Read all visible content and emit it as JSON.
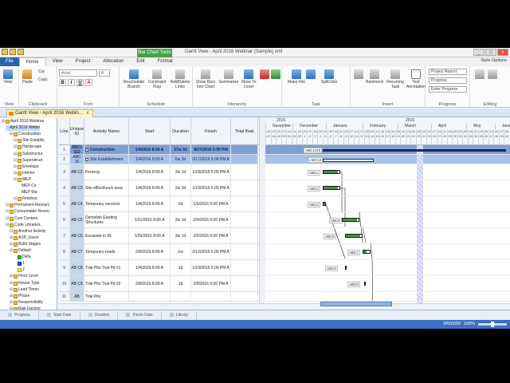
{
  "window": {
    "context_tab": "Bar Chart Tools",
    "title": "Gantt View - April 2016 Webinar (Sample).xml",
    "controls": [
      "_",
      "□",
      "x"
    ]
  },
  "ribbon_tabs": [
    "File",
    "Home",
    "View",
    "Project",
    "Allocation",
    "Edit",
    "Format"
  ],
  "style_options": "Style Options",
  "ribbon": {
    "view": {
      "label": "View",
      "group": "View"
    },
    "clipboard": {
      "paste": "Paste",
      "cut": "Cut",
      "copy": "Copy",
      "group": "Clipboard"
    },
    "font": {
      "name": "Arial",
      "size": "8",
      "group": "Font",
      "buttons": [
        "B",
        "I",
        "U",
        "A"
      ]
    },
    "schedule": {
      "reschedule": "Reschedule Branch",
      "constraint": "Constraint Flag",
      "add_links": "Add/Delete Links",
      "group": "Schedule"
    },
    "hierarchy": {
      "show_bars": "Show Bars Into Chart",
      "summarize": "Summarize",
      "show_to_level": "Show To Level",
      "group": "Hierarchy"
    },
    "task": {
      "make_into": "Make Into",
      "split_join": "Split/Join",
      "group": "Task"
    },
    "insert": {
      "hammock": "Hammock",
      "recurring": "Recurring Task",
      "text_annotation": "Text Annotation",
      "group": "Insert"
    },
    "progress": {
      "project_report": "Project Report",
      "progress": "Progress",
      "enter_progress": "Enter Progress",
      "group": "Progress"
    },
    "editing": {
      "group": "Editing"
    }
  },
  "doc_tab": {
    "label": "Gantt View - April 2016 Webin...",
    "close": "x"
  },
  "tree": [
    {
      "label": "April 2016 Webinar",
      "level": 0,
      "icon": "folder"
    },
    {
      "label": "April 2016 Webin",
      "level": 1,
      "icon": "grid",
      "selected": true
    },
    {
      "label": "Construction",
      "level": 2,
      "icon": "folder"
    },
    {
      "label": "Site Establis",
      "level": 3,
      "icon": "folder"
    },
    {
      "label": "Hardscape",
      "level": 3,
      "icon": "folder"
    },
    {
      "label": "Substructur",
      "level": 3,
      "icon": "folder"
    },
    {
      "label": "Superstruct",
      "level": 3,
      "icon": "folder"
    },
    {
      "label": "Envelope",
      "level": 3,
      "icon": "folder"
    },
    {
      "label": "Interior",
      "level": 3,
      "icon": "folder"
    },
    {
      "label": "MEP",
      "level": 3,
      "icon": "folder"
    },
    {
      "label": "MEP Ce",
      "level": 4,
      "icon": "grid"
    },
    {
      "label": "MEP Wa",
      "level": 4,
      "icon": "grid"
    },
    {
      "label": "Finishes",
      "level": 3,
      "icon": "folder"
    },
    {
      "label": "Permanent Resourc",
      "level": 1,
      "icon": "folder"
    },
    {
      "label": "Consumable Resou",
      "level": 1,
      "icon": "folder"
    },
    {
      "label": "Cost Centers",
      "level": 1,
      "icon": "folder"
    },
    {
      "label": "Code Libraries",
      "level": 1,
      "icon": "folder"
    },
    {
      "label": "Another Activity",
      "level": 2,
      "icon": "folder"
    },
    {
      "label": "ASP_Users",
      "level": 2,
      "icon": "folder"
    },
    {
      "label": "Build Stages",
      "level": 2,
      "icon": "folder"
    },
    {
      "label": "Default",
      "level": 2,
      "icon": "folder"
    },
    {
      "label": "Defa",
      "level": 3,
      "icon": "sw-green"
    },
    {
      "label": "1",
      "level": 3,
      "icon": "sw-blue"
    },
    {
      "label": "2",
      "level": 3,
      "icon": "sw-yellow"
    },
    {
      "label": "Floor Level",
      "level": 2,
      "icon": "folder"
    },
    {
      "label": "House Type",
      "level": 2,
      "icon": "folder"
    },
    {
      "label": "Lead Times",
      "level": 2,
      "icon": "folder"
    },
    {
      "label": "Phase",
      "level": 2,
      "icon": "folder"
    },
    {
      "label": "Responsibility",
      "level": 2,
      "icon": "folder"
    },
    {
      "label": "Risk Factors",
      "level": 2,
      "icon": "folder"
    }
  ],
  "grid": {
    "headers": [
      "Line",
      "Unique ID",
      "Activity Name",
      "Start",
      "Duration",
      "Finish",
      "Total float"
    ],
    "rows": [
      {
        "line": "1",
        "uid": "ABC1 310",
        "name": "Construction",
        "start": "1/4/2016 8:00 A",
        "duration": "37w 3d",
        "finish": "8/27/2016 5:00 PM",
        "float": "",
        "kind": "sum1"
      },
      {
        "line": "2",
        "uid": "ABC 10",
        "name": "Site Establishment",
        "start": "1/4/2016 8:00 A",
        "duration": "6w 3d",
        "finish": "2/17/2016 5:00 PM A",
        "float": "",
        "kind": "sum2"
      },
      {
        "line": "3",
        "uid": "AB C2",
        "name": "Fencing",
        "start": "1/4/2016 8:00 A",
        "duration": "2w 1d",
        "finish": "1/18/2016 5:00 PM A",
        "float": "",
        "kind": "task"
      },
      {
        "line": "4",
        "uid": "AB C3",
        "name": "Site office/lunch area",
        "start": "1/4/2016 8:00 A",
        "duration": "2w 2d",
        "finish": "1/19/2016 5:00 PM A",
        "float": "",
        "kind": "task"
      },
      {
        "line": "5",
        "uid": "AB C4",
        "name": "Temporary services",
        "start": "1/4/2016 8:00 A",
        "duration": "2d",
        "finish": "1/5/2016 5:00 PM A",
        "float": "",
        "kind": "task"
      },
      {
        "line": "6",
        "uid": "AB C5",
        "name": "Demolish Existing Structures",
        "start": "1/21/2016 8:00 A",
        "duration": "2w 1d",
        "finish": "2/4/2016 5:00 PM A",
        "float": "",
        "kind": "task"
      },
      {
        "line": "7",
        "uid": "AB C6",
        "name": "Excavate to RL",
        "start": "1/25/2016 8:00 A",
        "duration": "3w 1d",
        "finish": "2/5/2016 5:00 PM A",
        "float": "",
        "kind": "task"
      },
      {
        "line": "8",
        "uid": "AB C7",
        "name": "Temporary roads",
        "start": "2/8/2016 8:00 A",
        "duration": "1w",
        "finish": "2/12/2016 5:00 PM A",
        "float": "",
        "kind": "task"
      },
      {
        "line": "9",
        "uid": "AB C8",
        "name": "Trial Pits Trial Pit #1",
        "start": "1/4/2016 8:00 A",
        "duration": "1d",
        "finish": "1/19/2016 5:00 PM A",
        "float": "",
        "kind": "task"
      },
      {
        "line": "10",
        "uid": "AB C9",
        "name": "Trial Pits Trial Pit #2",
        "start": "2/8/2016 8:00 A",
        "duration": "1d",
        "finish": "2/8/2016 5:00 PM A",
        "float": "",
        "kind": "task"
      },
      {
        "line": "11",
        "uid": "AB",
        "name": "Trial Pits",
        "start": "",
        "duration": "",
        "finish": "",
        "float": "",
        "kind": "task"
      }
    ]
  },
  "timescale": {
    "year_left": "2015",
    "year_right": "2016",
    "months": [
      "November",
      "December",
      "January",
      "February",
      "March",
      "April",
      "May",
      "June"
    ],
    "ticks": [
      ",16",
      ",23",
      ",30",
      ",07",
      ",14",
      ",21",
      ",28",
      ",04",
      ",11",
      ",18",
      ",25",
      ",01",
      ",08",
      ",15",
      ",22",
      ",29",
      ",07",
      ",14",
      ",21",
      ",28",
      ",04",
      ",11",
      ",18",
      ",25",
      ",02",
      ",09",
      ",16",
      ",23",
      ",30",
      ",06",
      ",13",
      ",20",
      ",27",
      ",04",
      ",11",
      ",18",
      ",25",
      ",01",
      ",08",
      ",15",
      ",22",
      ",29",
      ",06",
      ",13",
      ",20",
      ",27",
      ",06",
      ",13",
      ",20"
    ],
    "week_numbers": [
      ",47",
      ",48",
      ",49",
      ",50",
      ",51",
      ",52",
      ",53",
      ",1",
      ",2",
      ",3",
      ",4",
      ",5",
      ",6",
      ",7",
      ",8",
      ",9",
      ",10",
      ",11",
      ",12",
      ",13",
      ",14",
      ",15",
      ",16",
      ",17",
      ",18",
      ",19",
      ",20",
      ",21",
      ",22",
      ",23",
      ",24",
      ",25",
      ",26",
      ",27",
      ",28",
      ",29",
      ",30",
      ",31",
      ",32",
      ",33",
      ",34",
      ",35",
      ",36",
      ",37",
      ",38",
      ",39",
      ",40",
      ",41"
    ]
  },
  "gantt_labels": [
    "ABC1310",
    "ABC10",
    "ABC2",
    "ABC3",
    "ABC4",
    "ABC5",
    "ABC6",
    "ABC7",
    "ABC8",
    "ABC9"
  ],
  "bottom_fields": [
    "Progress",
    "Start Date",
    "Duration",
    "Finish Date",
    "Library"
  ],
  "status": {
    "counts": "0/0/0000",
    "zoom": "100%"
  },
  "colors": {
    "accent": "#2a62b0",
    "progress": "#3d9a3d",
    "summary": "#7f9fd3",
    "context": "#46a346"
  }
}
